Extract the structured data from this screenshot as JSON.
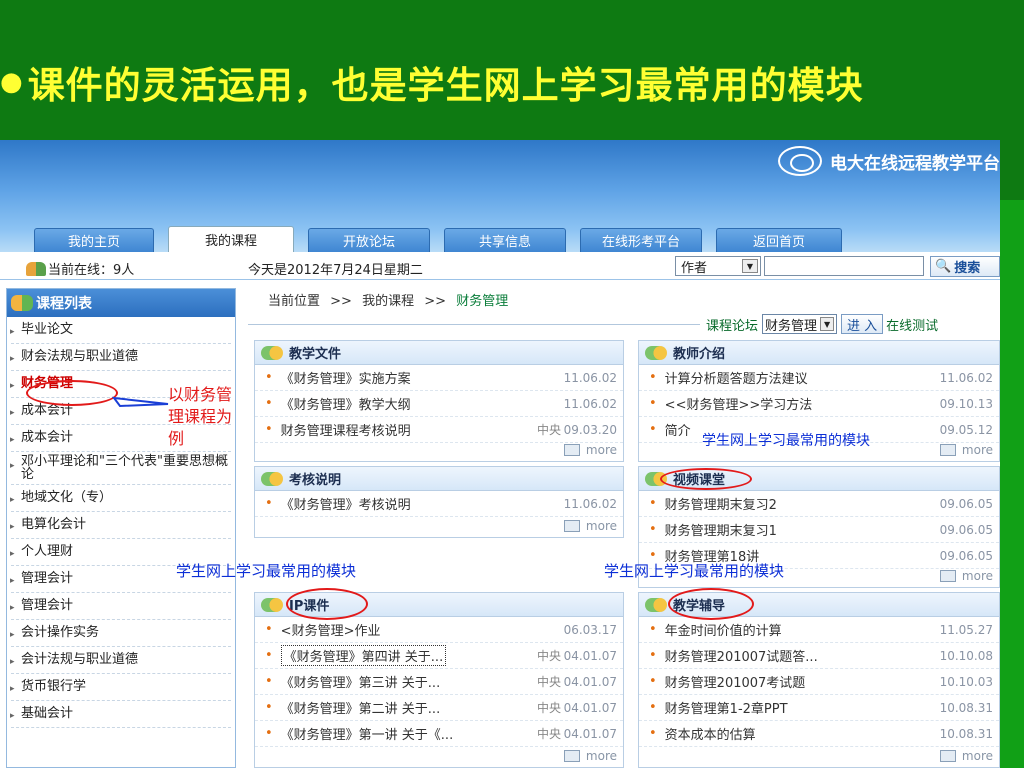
{
  "slide": {
    "title": "课件的灵活运用，也是学生网上学习最常用的模块",
    "title_color": "#ffff33",
    "background": "#0e7a12"
  },
  "site": {
    "logo_text": "电大在线远程教学平台"
  },
  "nav": {
    "tabs": [
      "我的主页",
      "我的课程",
      "开放论坛",
      "共享信息",
      "在线形考平台",
      "返回首页"
    ],
    "active": "我的课程"
  },
  "status": {
    "online": "当前在线：9人",
    "today": "今天是2012年7月24日星期二",
    "search_field": "作者",
    "search_button": "搜索"
  },
  "sidebar": {
    "title": "课程列表",
    "items": [
      "毕业论文",
      "财会法规与职业道德",
      "财务管理",
      "成本会计",
      "成本会计",
      "邓小平理论和\"三个代表\"重要思想概论",
      "地域文化（专）",
      "电算化会计",
      "个人理财",
      "管理会计",
      "管理会计",
      "会计操作实务",
      "会计法规与职业道德",
      "货币银行学",
      "基础会计"
    ],
    "current_index": 2
  },
  "breadcrumb": {
    "label": "当前位置",
    "sep": ">>",
    "parent": "我的课程",
    "current": "财务管理"
  },
  "forum": {
    "label": "课程论坛",
    "select": "财务管理",
    "enter": "进 入",
    "next": "在线测试"
  },
  "panels": {
    "teaching_docs": {
      "title": "教学文件",
      "rows": [
        {
          "text": "《财务管理》实施方案",
          "src": "",
          "date": "11.06.02"
        },
        {
          "text": "《财务管理》教学大纲",
          "src": "",
          "date": "11.06.02"
        },
        {
          "text": "财务管理课程考核说明",
          "src": "中央",
          "date": "09.03.20"
        }
      ],
      "more": "more"
    },
    "teacher": {
      "title": "教师介绍",
      "rows": [
        {
          "text": "计算分析题答题方法建议",
          "src": "",
          "date": "11.06.02"
        },
        {
          "text": "<<财务管理>>学习方法",
          "src": "",
          "date": "09.10.13"
        },
        {
          "text": "简介",
          "src": "",
          "date": "09.05.12"
        }
      ],
      "more": "more"
    },
    "exam": {
      "title": "考核说明",
      "rows": [
        {
          "text": "《财务管理》考核说明",
          "src": "",
          "date": "11.06.02"
        }
      ],
      "more": "more"
    },
    "video": {
      "title": "视频课堂",
      "rows": [
        {
          "text": "财务管理期末复习2",
          "src": "",
          "date": "09.06.05"
        },
        {
          "text": "财务管理期末复习1",
          "src": "",
          "date": "09.06.05"
        },
        {
          "text": "财务管理第18讲",
          "src": "",
          "date": "09.06.05"
        }
      ],
      "more": "more"
    },
    "ip": {
      "title": "IP课件",
      "rows": [
        {
          "text": "<财务管理>作业",
          "src": "",
          "date": "06.03.17"
        },
        {
          "text": "《财务管理》第四讲 关于...",
          "src": "中央",
          "date": "04.01.07"
        },
        {
          "text": "《财务管理》第三讲 关于...",
          "src": "中央",
          "date": "04.01.07"
        },
        {
          "text": "《财务管理》第二讲 关于...",
          "src": "中央",
          "date": "04.01.07"
        },
        {
          "text": "《财务管理》第一讲 关于《...",
          "src": "中央",
          "date": "04.01.07"
        }
      ],
      "more": "more"
    },
    "tutor": {
      "title": "教学辅导",
      "rows": [
        {
          "text": "年金时间价值的计算",
          "src": "",
          "date": "11.05.27"
        },
        {
          "text": "财务管理201007试题答...",
          "src": "",
          "date": "10.10.08"
        },
        {
          "text": "财务管理201007考试题",
          "src": "",
          "date": "10.10.03"
        },
        {
          "text": "财务管理第1-2章PPT",
          "src": "",
          "date": "10.08.31"
        },
        {
          "text": "资本成本的估算",
          "src": "",
          "date": "10.08.31"
        }
      ],
      "more": "more"
    }
  },
  "annotations": {
    "example_note": "以财务管理课程为例",
    "video_note": "学生网上学习最常用的模块",
    "ip_note": "学生网上学习最常用的模块",
    "tutor_note": "学生网上学习最常用的模块"
  }
}
